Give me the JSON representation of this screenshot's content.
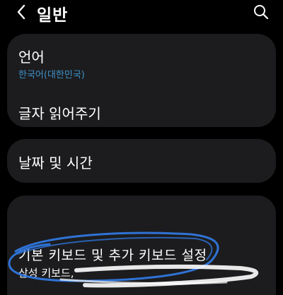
{
  "header": {
    "title": "일반",
    "back_icon": "chevron-left-icon",
    "search_icon": "search-icon"
  },
  "items": {
    "language": {
      "title": "언어",
      "subtitle": "한국어(대한민국)"
    },
    "tts": {
      "title": "글자 읽어주기"
    },
    "date_time": {
      "title": "날짜 및 시간"
    },
    "keyboard": {
      "title": "기본 키보드 및 추가 키보드 설정",
      "subtitle": "삼성 키보드,"
    }
  },
  "colors": {
    "background": "#000000",
    "card": "#1c1c1e",
    "accent": "#3e91c9",
    "highlight_scribble": "#2f73d6"
  }
}
